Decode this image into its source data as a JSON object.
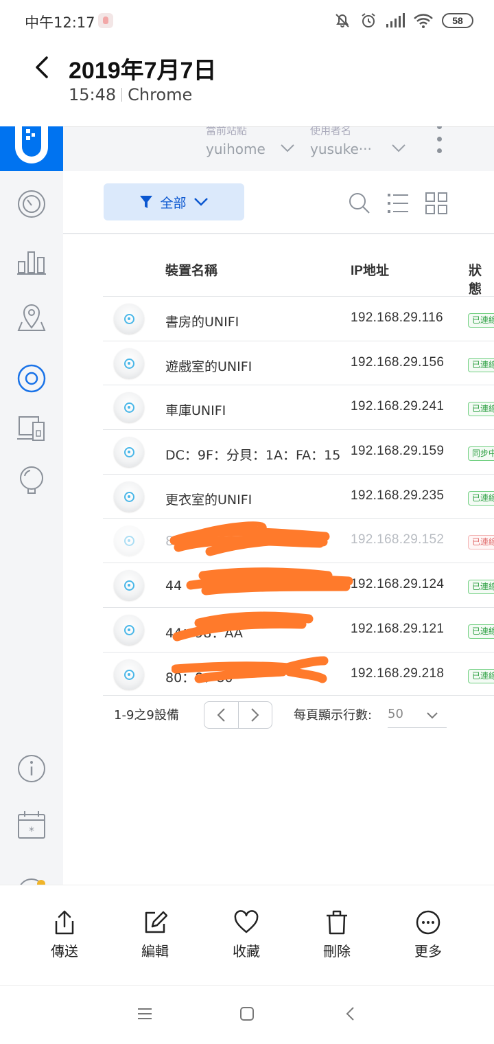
{
  "status_bar": {
    "time": "中午12:17",
    "battery": "58"
  },
  "gallery": {
    "title": "2019年7月7日",
    "time": "15:48",
    "source": "Chrome"
  },
  "app": {
    "site_label": "當前站點",
    "site_value": "yuihome",
    "user_label": "使用者名",
    "user_value": "yusuke···",
    "filter_label": "全部",
    "columns": {
      "name": "裝置名稱",
      "ip": "IP地址",
      "status": "狀態"
    },
    "devices": [
      {
        "name": "書房的UNIFI",
        "ip": "192.168.29.116",
        "status": "已連線"
      },
      {
        "name": "遊戲室的UNIFI",
        "ip": "192.168.29.156",
        "status": "已連線"
      },
      {
        "name": "車庫UNIFI",
        "ip": "192.168.29.241",
        "status": "已連線"
      },
      {
        "name": "DC：9F：分貝：1A：FA：15",
        "ip": "192.168.29.159",
        "status": "同步中"
      },
      {
        "name": "更衣室的UNIFI",
        "ip": "192.168.29.235",
        "status": "已連線"
      },
      {
        "name": "80",
        "ip": "192.168.29.152",
        "status": "已連線"
      },
      {
        "name": "44",
        "ip": "192.168.29.124",
        "status": "已連線"
      },
      {
        "name": "44：98：AA",
        "ip": "192.168.29.121",
        "status": "已連線"
      },
      {
        "name": "80：8：80",
        "ip": "192.168.29.218",
        "status": "已連線"
      }
    ],
    "pager": {
      "summary": "1-9之9設備",
      "per_page_label": "每頁顯示行數:",
      "per_page_value": "50"
    }
  },
  "actions": [
    {
      "label": "傳送",
      "icon": "share-icon"
    },
    {
      "label": "編輯",
      "icon": "edit-icon"
    },
    {
      "label": "收藏",
      "icon": "heart-icon"
    },
    {
      "label": "刪除",
      "icon": "trash-icon"
    },
    {
      "label": "更多",
      "icon": "more-icon"
    }
  ]
}
